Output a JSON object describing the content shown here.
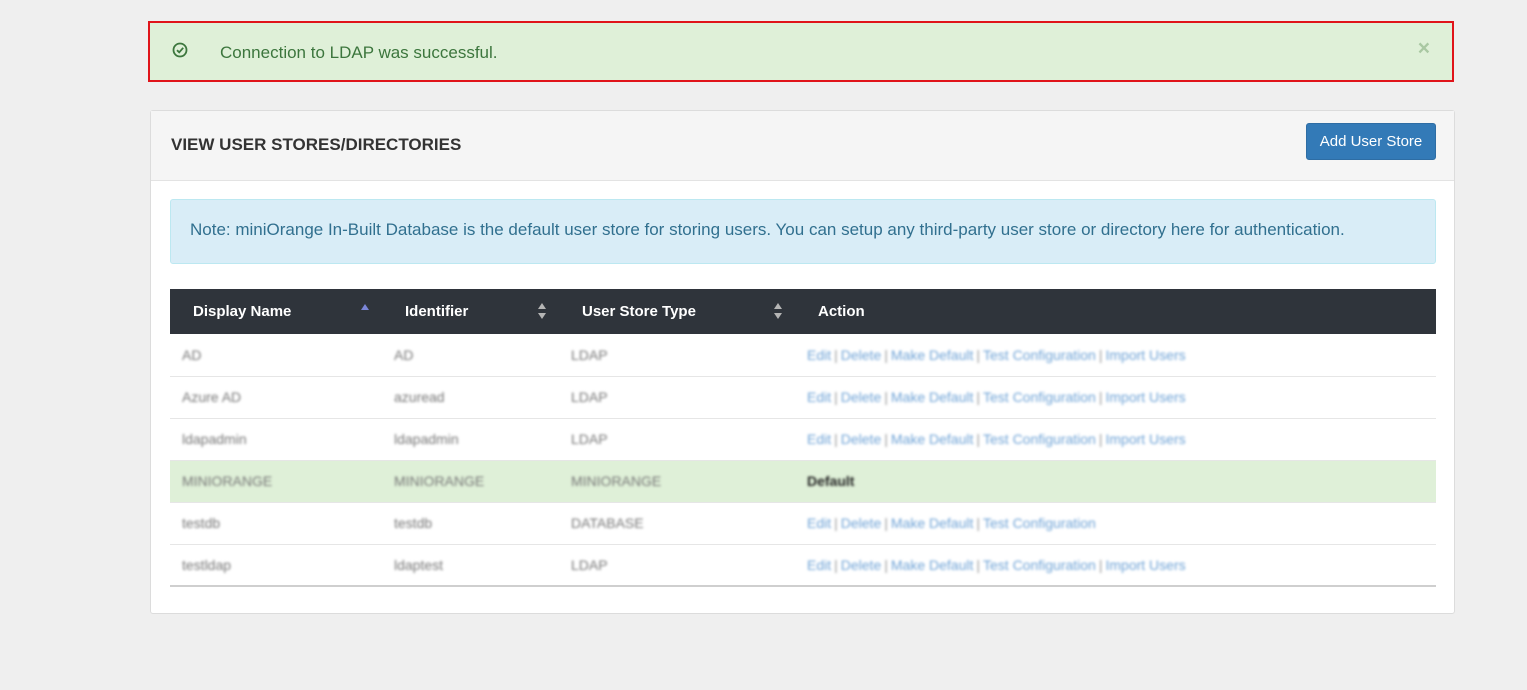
{
  "alert": {
    "message": "Connection to LDAP was successful.",
    "close": "×"
  },
  "panel": {
    "title": "VIEW USER STORES/DIRECTORIES",
    "add_button": "Add User Store",
    "note": "Note: miniOrange In-Built Database is the default user store for storing users. You can setup any third-party user store or directory here for authentication."
  },
  "table": {
    "headers": [
      "Display Name",
      "Identifier",
      "User Store Type",
      "Action"
    ],
    "rows": [
      {
        "name": "AD",
        "id": "AD",
        "type": "LDAP",
        "actions": [
          "Edit",
          "Delete",
          "Make Default",
          "Test Configuration",
          "Import Users"
        ]
      },
      {
        "name": "Azure AD",
        "id": "azuread",
        "type": "LDAP",
        "actions": [
          "Edit",
          "Delete",
          "Make Default",
          "Test Configuration",
          "Import Users"
        ]
      },
      {
        "name": "ldapadmin",
        "id": "ldapadmin",
        "type": "LDAP",
        "actions": [
          "Edit",
          "Delete",
          "Make Default",
          "Test Configuration",
          "Import Users"
        ]
      },
      {
        "name": "MINIORANGE",
        "id": "MINIORANGE",
        "type": "MINIORANGE",
        "default": "Default"
      },
      {
        "name": "testdb",
        "id": "testdb",
        "type": "DATABASE",
        "actions": [
          "Edit",
          "Delete",
          "Make Default",
          "Test Configuration"
        ]
      },
      {
        "name": "testldap",
        "id": "ldaptest",
        "type": "LDAP",
        "actions": [
          "Edit",
          "Delete",
          "Make Default",
          "Test Configuration",
          "Import Users"
        ]
      }
    ]
  },
  "colors": {
    "alert_bg": "#dff0d8",
    "alert_border": "#e0141a",
    "primary": "#337ab7",
    "table_header": "#2f343b",
    "info_bg": "#d9edf7"
  }
}
